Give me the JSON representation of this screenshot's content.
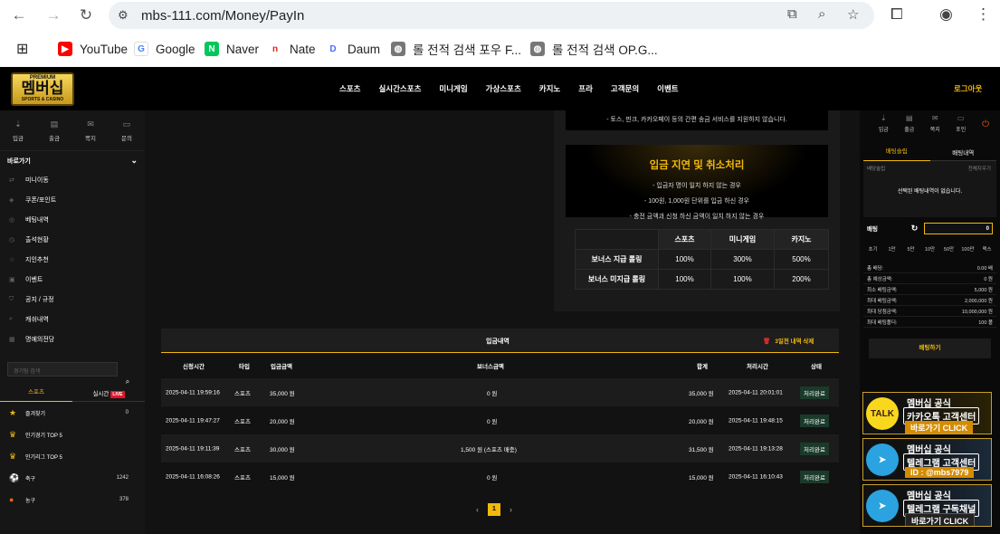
{
  "browser": {
    "url": "mbs-111.com/Money/PayIn",
    "bookmarks": [
      {
        "label": "YouTube",
        "icon": "youtube-icon"
      },
      {
        "label": "Google",
        "icon": "google-icon"
      },
      {
        "label": "Naver",
        "icon": "naver-icon"
      },
      {
        "label": "Nate",
        "icon": "nate-icon"
      },
      {
        "label": "Daum",
        "icon": "daum-icon"
      },
      {
        "label": "롤 전적 검색 포우 F...",
        "icon": "globe-icon"
      },
      {
        "label": "롤 전적 검색 OP.G...",
        "icon": "globe-icon"
      }
    ]
  },
  "site": {
    "logo_premium": "PREMIUM",
    "logo_text": "멤버십",
    "logo_sub": "SPORTS & CASINO",
    "nav": [
      "스포츠",
      "실시간스포츠",
      "미니게임",
      "가상스포츠",
      "카지노",
      "프라",
      "고객문의",
      "이벤트"
    ],
    "logout": "로그아웃"
  },
  "left": {
    "quick": [
      "입금",
      "출금",
      "쪽지",
      "문의"
    ],
    "section": "바로가기",
    "links": [
      "미니이동",
      "쿠폰/포인트",
      "베팅내역",
      "출석현황",
      "지인추천",
      "이벤트",
      "공지 / 규정",
      "캐쉬내역",
      "명예의전당"
    ],
    "search_placeholder": "경기팀 검색",
    "tabs": [
      "스포츠",
      "실시간"
    ],
    "live_badge": "LIVE",
    "sports": [
      {
        "name": "즐겨찾기",
        "count": "0"
      },
      {
        "name": "인기경기 TOP 5",
        "count": ""
      },
      {
        "name": "인기리그 TOP 5",
        "count": ""
      },
      {
        "name": "축구",
        "count": "1242"
      },
      {
        "name": "농구",
        "count": "378"
      }
    ]
  },
  "promo": {
    "top_line": "- 토스, 핀크, 카카오페이 등의 간편 송금 서비스를 지원하지 않습니다.",
    "delay_title": "입금 지연 및 취소처리",
    "delay_lines": [
      "- 입금자 명이 일치 하지 않는 경우",
      "- 100원, 1,000원 단위를 입금 하신 경우",
      "- 충전 금액과 신청 하신 금액이 일치 하지 않는 경우"
    ],
    "bonus_headers": [
      "스포츠",
      "미니게임",
      "카지노"
    ],
    "bonus_rows": [
      {
        "label": "보너스 지급 롤링",
        "values": [
          "100%",
          "300%",
          "500%"
        ]
      },
      {
        "label": "보너스 미지급 롤링",
        "values": [
          "100%",
          "100%",
          "200%"
        ]
      }
    ]
  },
  "deposits": {
    "title": "입금내역",
    "delete_label": "3일전 내역 삭제",
    "columns": [
      "신청시간",
      "타입",
      "입금금액",
      "보너스금액",
      "합계",
      "처리시간",
      "상태"
    ],
    "rows": [
      {
        "time": "2025-04-11 19:59:16",
        "type": "스포츠",
        "amount": "35,000 원",
        "bonus": "0 원",
        "total": "35,000 원",
        "done": "2025-04-11 20:01:01",
        "status": "처리완료"
      },
      {
        "time": "2025-04-11 19:47:27",
        "type": "스포츠",
        "amount": "20,000 원",
        "bonus": "0 원",
        "total": "20,000 원",
        "done": "2025-04-11 19:48:15",
        "status": "처리완료"
      },
      {
        "time": "2025-04-11 19:11:39",
        "type": "스포츠",
        "amount": "30,000 원",
        "bonus": "1,500 원 (스포츠 매충)",
        "total": "31,500 원",
        "done": "2025-04-11 19:13:28",
        "status": "처리완료"
      },
      {
        "time": "2025-04-11 16:08:26",
        "type": "스포츠",
        "amount": "15,000 원",
        "bonus": "0 원",
        "total": "15,000 원",
        "done": "2025-04-11 16:10:43",
        "status": "처리완료"
      }
    ],
    "page": "1"
  },
  "right": {
    "quick": [
      "입금",
      "출금",
      "쪽지",
      "포인"
    ],
    "tabs": [
      "배팅슬립",
      "배팅내역"
    ],
    "slip_label": "배당슬립",
    "slip_clear": "전체지우기",
    "slip_empty": "선택된 배팅내역이 없습니다.",
    "stake_label": "배팅",
    "stake_value": "0",
    "amounts": [
      "초기",
      "1만",
      "5만",
      "10만",
      "50만",
      "100만",
      "맥스"
    ],
    "info": [
      {
        "label": "총 배당:",
        "value": "0.00 배"
      },
      {
        "label": "총 예상금액:",
        "value": "0 원"
      },
      {
        "label": "최소 배팅금액:",
        "value": "5,000 원"
      },
      {
        "label": "최대 배팅금액:",
        "value": "2,000,000 원"
      },
      {
        "label": "최대 당첨금액:",
        "value": "10,000,000 원"
      },
      {
        "label": "최대 배팅폴더:",
        "value": "100 폴"
      }
    ],
    "bet_button": "배팅하기"
  },
  "banners": [
    {
      "line1": "멤버십 공식",
      "line2": "카카오톡 고객센터",
      "line3": "바로가기 CLICK",
      "icon": "kakaotalk-icon",
      "icon_text": "TALK"
    },
    {
      "line1": "멤버십 공식",
      "line2": "텔레그램 고객센터",
      "line3": "ID : @mbs7979",
      "icon": "telegram-icon",
      "icon_text": "➤"
    },
    {
      "line1": "멤버십 공식",
      "line2": "텔레그램 구독채널",
      "line3": "바로가기 CLICK",
      "icon": "telegram-icon",
      "icon_text": "➤"
    }
  ]
}
